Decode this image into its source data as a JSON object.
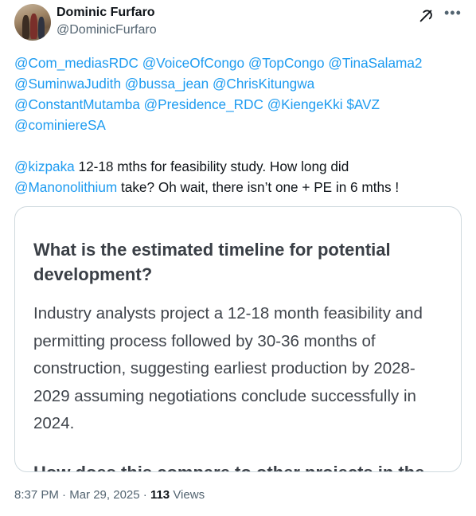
{
  "author": {
    "name": "Dominic Furfaro",
    "handle": "@DominicFurfaro"
  },
  "icons": {
    "grok": "grok-icon",
    "more": "more-options-icon"
  },
  "tweet": {
    "mentions_line1": [
      "@Com_mediasRDC",
      "@VoiceOfCongo",
      "@TopCongo",
      "@TinaSalama2"
    ],
    "mentions_line2": [
      "@SuminwaJudith",
      "@bussa_jean",
      "@ChrisKitungwa"
    ],
    "mentions_line3": [
      "@ConstantMutamba",
      "@Presidence_RDC",
      "@KiengeKki",
      "$AVZ"
    ],
    "mentions_line4": [
      "@cominiereSA"
    ],
    "body_mention1": "@kizpaka",
    "body_text1": " 12-18 mths for feasibility study. How long did",
    "body_mention2": "@Manonolithium",
    "body_text2": " take? Oh wait, there isn’t one + PE in 6 mths !"
  },
  "card": {
    "question": "What is the estimated timeline for potential development?",
    "answer": "Industry analysts project a 12-18 month feasibility and permitting process followed by 30-36 months of construction, suggesting earliest production by 2028-2029 assuming negotiations conclude successfully in 2024.",
    "next_heading_cut": "How does this compare to other projects in the region?"
  },
  "meta": {
    "time": "8:37 PM",
    "separator": " · ",
    "date": "Mar 29, 2025",
    "views_count": "113",
    "views_label": " Views"
  },
  "colors": {
    "link": "#1d9bf0",
    "text": "#0f1419",
    "secondary": "#536471",
    "border": "#cfd9de"
  }
}
